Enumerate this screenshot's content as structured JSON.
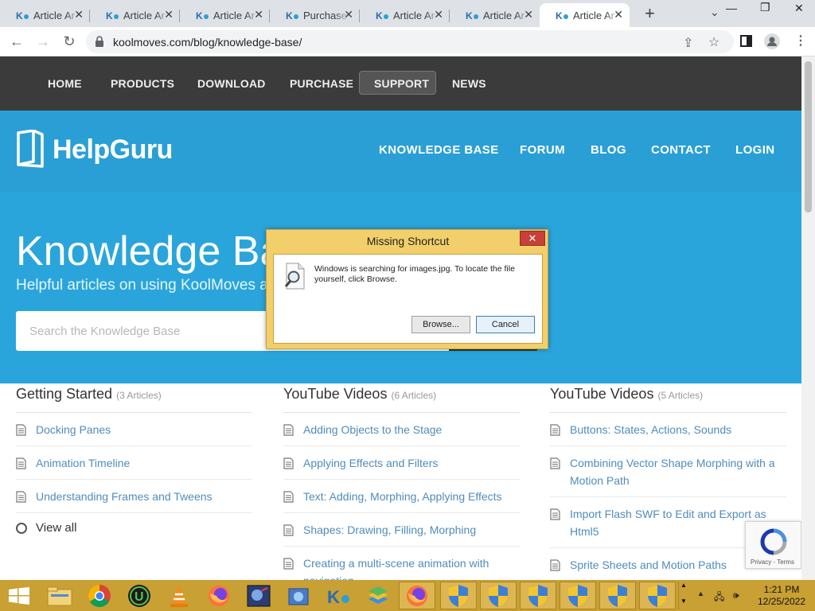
{
  "browser": {
    "tabs": [
      {
        "title": "Article Ar",
        "active": false
      },
      {
        "title": "Article Ar",
        "active": false
      },
      {
        "title": "Article Ar",
        "active": false
      },
      {
        "title": "Purchase",
        "active": false
      },
      {
        "title": "Article Ar",
        "active": false
      },
      {
        "title": "Article Ar",
        "active": false
      },
      {
        "title": "Article Ar",
        "active": true
      }
    ],
    "url": "koolmoves.com/blog/knowledge-base/"
  },
  "topnav": {
    "home": "HOME",
    "products": "PRODUCTS",
    "download": "DOWNLOAD",
    "purchase": "PURCHASE",
    "support": "SUPPORT",
    "news": "NEWS"
  },
  "header": {
    "logo": "HelpGuru",
    "nav": {
      "knowledge_base": "KNOWLEDGE BASE",
      "forum": "FORUM",
      "blog": "BLOG",
      "contact": "CONTACT",
      "login": "LOGIN"
    }
  },
  "hero": {
    "title": "Knowledge Base",
    "subtitle": "Helpful articles on using KoolMoves and its features",
    "search_placeholder": "Search the Knowledge Base"
  },
  "columns": [
    {
      "title": "Getting Started",
      "count": "(3 Articles)",
      "articles": [
        "Docking Panes",
        "Animation Timeline",
        "Understanding Frames and Tweens"
      ],
      "view_all": "View all"
    },
    {
      "title": "YouTube Videos",
      "count": "(6 Articles)",
      "articles": [
        "Adding Objects to the Stage",
        "Applying Effects and Filters",
        "Text: Adding, Morphing, Applying Effects",
        "Shapes: Drawing, Filling, Morphing",
        "Creating a multi-scene animation with navigation"
      ]
    },
    {
      "title": "YouTube Videos",
      "count": "(5 Articles)",
      "articles": [
        "Buttons: States, Actions, Sounds",
        "Combining Vector Shape Morphing with a Motion Path",
        "Import Flash SWF to Edit and Export as Html5",
        "Sprite Sheets and Motion Paths"
      ]
    }
  ],
  "recaptcha": {
    "links": "Privacy - Terms"
  },
  "dialog": {
    "title": "Missing Shortcut",
    "close": "✕",
    "message": "Windows is searching for images.jpg. To locate the file yourself, click Browse.",
    "browse": "Browse...",
    "cancel": "Cancel"
  },
  "taskbar": {
    "time": "1:21 PM",
    "date": "12/25/2022",
    "color": "#c8a033"
  },
  "colors": {
    "topnav_bg": "#3b3b3b",
    "header_bg": "#2a9fd6",
    "link": "#508cbb"
  }
}
